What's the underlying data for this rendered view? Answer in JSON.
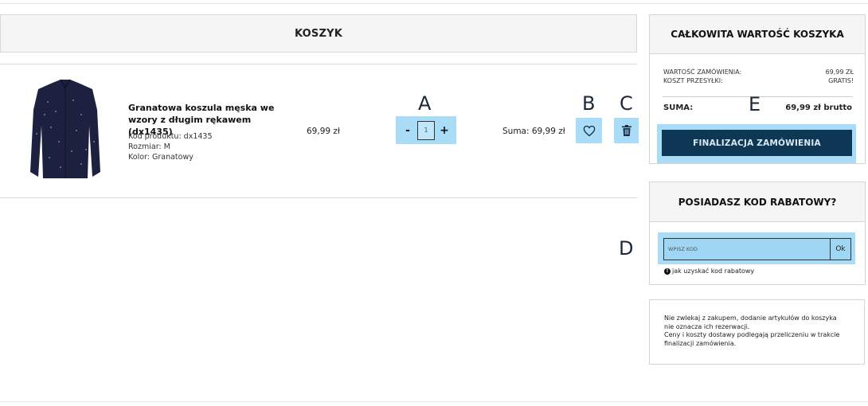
{
  "cart": {
    "header": "KOSZYK",
    "product": {
      "title": "Granatowa koszula męska we wzory z długim rękawem (dx1435)",
      "code_line": "Kod produktu: dx1435",
      "size_line": "Rozmiar: M",
      "color_line": "Kolor: Granatowy",
      "price": "69,99 zł",
      "quantity": "1",
      "qty_minus": "-",
      "qty_plus": "+",
      "sum": "Suma: 69,99 zł"
    },
    "icons": {
      "favorite": "heart-icon",
      "delete": "trash-icon"
    }
  },
  "annotations": {
    "a": "A",
    "b": "B",
    "c": "C",
    "d": "D",
    "e": "E"
  },
  "summary": {
    "header": "CAŁKOWITA WARTOŚĆ KOSZYKA",
    "order_value_label": "WARTOŚĆ ZAMÓWIENIA:",
    "order_value": "69,99 ZŁ",
    "shipping_label": "KOSZT PRZESYŁKI:",
    "shipping_value": "GRATIS!",
    "total_label": "SUMA:",
    "total_value": "69,99 zł brutto",
    "checkout_button": "FINALIZACJA ZAMÓWIENIA"
  },
  "coupon": {
    "header": "POSIADASZ KOD RABATOWY?",
    "placeholder": "WPISZ KOD",
    "ok_button": "Ok",
    "help_link": "jak uzyskać kod rabatowy"
  },
  "notice": {
    "line1": "Nie zwlekaj z zakupem, dodanie artykułów do koszyka nie oznacza ich rezerwacji.",
    "line2": "Ceny i koszty dostawy podlegają przeliczeniu w trakcie finalizacji zamówienia."
  },
  "colors": {
    "highlight": "#a9dcf7",
    "checkout": "#0e3756"
  }
}
